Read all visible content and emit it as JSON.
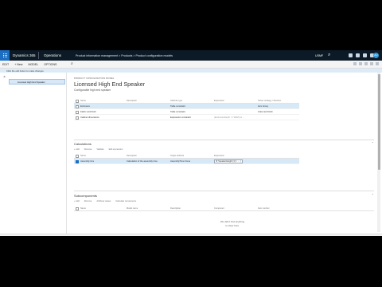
{
  "nav": {
    "brand": "Dynamics 365",
    "product": "Operations",
    "breadcrumb": "Product information management  >  Products  >  Product configuration models",
    "company": "USMF"
  },
  "actionbar": {
    "buttons": [
      "EDIT",
      "+ New",
      "MODEL",
      "OPTIONS"
    ]
  },
  "msgbar": {
    "text": "Click the edit button to make changes."
  },
  "sidebar": {
    "item": "Licensed High End Speaker"
  },
  "header": {
    "eyebrow": "PRODUCT CONFIGURATION MODEL",
    "title": "Licensed High End Speaker",
    "subtitle": "Configurable high end speaker"
  },
  "attributes": {
    "columns": [
      "Name",
      "Description",
      "Attribute type",
      "Expression",
      "Solver strategy / direction"
    ],
    "rows": [
      {
        "name": "Enclosure",
        "desc": "",
        "type": "Table constraint",
        "expr": "",
        "extra": "Item Group"
      },
      {
        "name": "Fabric and finish",
        "desc": "",
        "type": "Table constraint",
        "expr": "",
        "extra": "Color and finish"
      },
      {
        "name": "Cabinet dimensions",
        "desc": "",
        "type": "Expression constraint",
        "expr": "(EnclosureDepth >= Width) & ...",
        "extra": ""
      }
    ]
  },
  "calculations": {
    "title": "Calculations",
    "toolbar": [
      "+ Add",
      "Remove",
      "Validate",
      "Edit expression"
    ],
    "columns": [
      "Name",
      "Description",
      "Target attribute",
      "Expression"
    ],
    "rows": [
      {
        "name": "Assembly time",
        "desc": "Calculation of the assembly time",
        "target": "AssemblyTime Fome",
        "expr": "If( SpeakerHeight [1] > ... )"
      }
    ]
  },
  "subcomponents": {
    "title": "Subcomponents",
    "toolbar": [
      "+ Add",
      "Remove",
      "Attribute values",
      "Calculate components"
    ],
    "columns": [
      "Name",
      "Model name",
      "Description",
      "Component",
      "Item number"
    ],
    "empty_line1": "We didn't find anything",
    "empty_line2": "to show here."
  }
}
